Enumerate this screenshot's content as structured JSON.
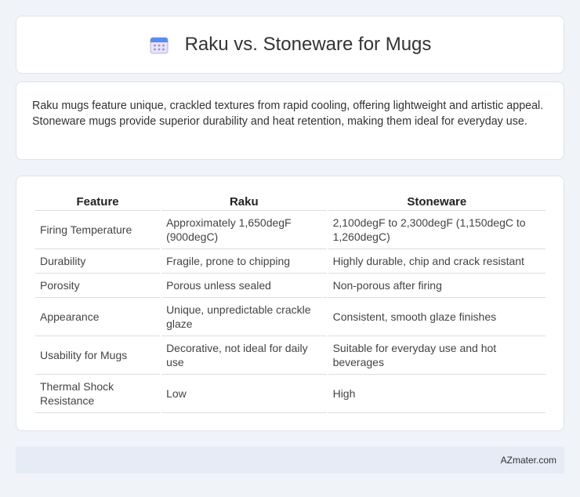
{
  "header": {
    "title": "Raku vs. Stoneware for Mugs",
    "icon": "calendar-icon"
  },
  "intro": {
    "text": "Raku mugs feature unique, crackled textures from rapid cooling, offering lightweight and artistic appeal. Stoneware mugs provide superior durability and heat retention, making them ideal for everyday use."
  },
  "table": {
    "headers": [
      "Feature",
      "Raku",
      "Stoneware"
    ],
    "rows": [
      [
        "Firing Temperature",
        "Approximately 1,650degF (900degC)",
        "2,100degF to 2,300degF (1,150degC to 1,260degC)"
      ],
      [
        "Durability",
        "Fragile, prone to chipping",
        "Highly durable, chip and crack resistant"
      ],
      [
        "Porosity",
        "Porous unless sealed",
        "Non-porous after firing"
      ],
      [
        "Appearance",
        "Unique, unpredictable crackle glaze",
        "Consistent, smooth glaze finishes"
      ],
      [
        "Usability for Mugs",
        "Decorative, not ideal for daily use",
        "Suitable for everyday use and hot beverages"
      ],
      [
        "Thermal Shock Resistance",
        "Low",
        "High"
      ]
    ]
  },
  "footer": {
    "text": "AZmater.com"
  }
}
